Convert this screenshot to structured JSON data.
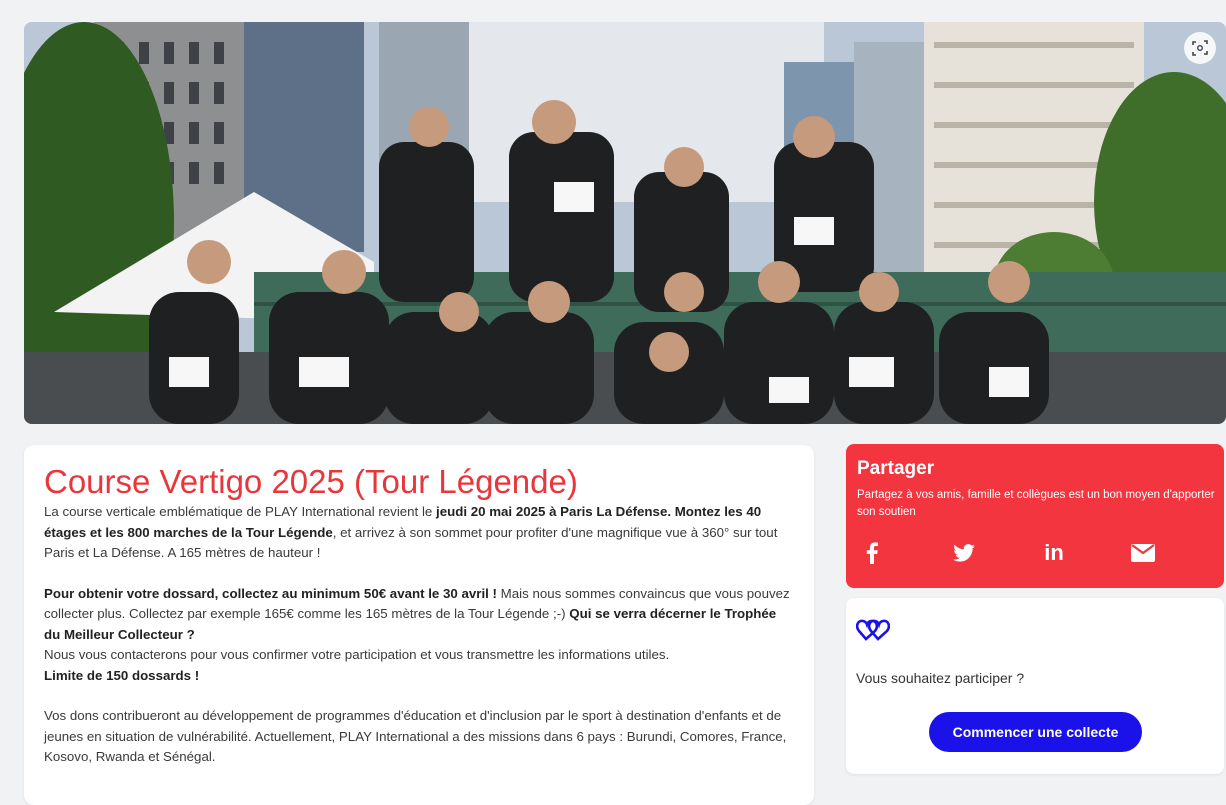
{
  "hero": {
    "scan_icon": "screenshot-scan-icon"
  },
  "event": {
    "title": "Course Vertigo 2025 (Tour Légende)",
    "p1_a": "La course verticale emblématique de PLAY International revient le ",
    "p1_b": "jeudi 20 mai 2025 à Paris La Défense. Montez les 40 étages et les 800 marches de la Tour Légende",
    "p1_c": ", et arrivez à son sommet pour profiter d'une magnifique vue à 360° sur tout Paris et La Défense. A 165 mètres de hauteur !",
    "p2_a": "Pour obtenir votre dossard, collectez au minimum 50€ avant le 30 avril !",
    "p2_b": " Mais nous sommes convaincus que vous pouvez collecter plus. Collectez par exemple 165€ comme les 165 mètres de la Tour Légende ;-) ",
    "p2_c": "Qui se verra décerner le Trophée du Meilleur Collecteur ?",
    "p2_d": "Nous vous contacterons pour vous confirmer votre participation et vous transmettre les informations utiles. ",
    "p2_e": "Limite de 150 dossards !",
    "p3": "Vos dons contribueront au développement de programmes d'éducation et d'inclusion par le sport à destination d'enfants et de jeunes en situation de vulnérabilité. Actuellement, PLAY International a des missions dans 6 pays : Burundi, Comores, France, Kosovo, Rwanda et Sénégal."
  },
  "share": {
    "title": "Partager",
    "text": "Partagez à vos amis, famille et collègues est un bon moyen d'apporter son soutien",
    "icons": [
      "facebook-icon",
      "twitter-icon",
      "linkedin-icon",
      "email-icon"
    ],
    "color": "#f2353f"
  },
  "participate": {
    "logo_icon": "double-heart-icon",
    "question": "Vous souhaitez participer ?",
    "button": "Commencer une collecte",
    "button_color": "#1a12e8"
  }
}
